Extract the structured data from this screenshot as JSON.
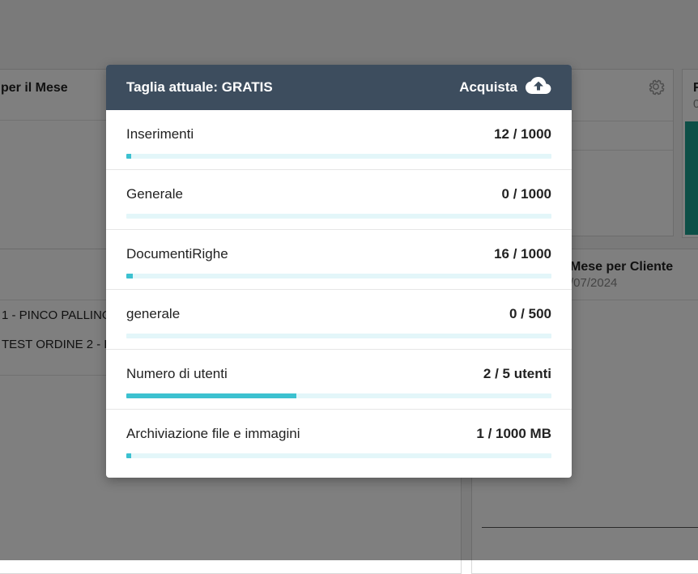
{
  "background": {
    "card_left_title": "per il Mese",
    "card_right_title": "R",
    "card_right_sub": "0",
    "card_cliente_title": "Mese per Cliente",
    "card_cliente_sub": "/07/2024",
    "list_items": [
      "1 - PINCO PALLINO",
      "TEST ORDINE 2 - P"
    ]
  },
  "modal": {
    "title": "Taglia attuale: GRATIS",
    "buy_label": "Acquista",
    "rows": [
      {
        "label": "Inserimenti",
        "value": "12 / 1000",
        "used": 12,
        "limit": 1000
      },
      {
        "label": "Generale",
        "value": "0 / 1000",
        "used": 0,
        "limit": 1000
      },
      {
        "label": "DocumentiRighe",
        "value": "16 / 1000",
        "used": 16,
        "limit": 1000
      },
      {
        "label": "generale",
        "value": "0 / 500",
        "used": 0,
        "limit": 500
      },
      {
        "label": "Numero di utenti",
        "value": "2 / 5 utenti",
        "used": 2,
        "limit": 5
      },
      {
        "label": "Archiviazione file e immagini",
        "value": "1 / 1000 MB",
        "used": 1,
        "limit": 1000
      }
    ]
  },
  "colors": {
    "header_bg": "#3d4d5e",
    "bar_fill": "#3cc1d0",
    "bar_track": "#e3f6f9",
    "accent_teal": "#1a9f8f"
  }
}
